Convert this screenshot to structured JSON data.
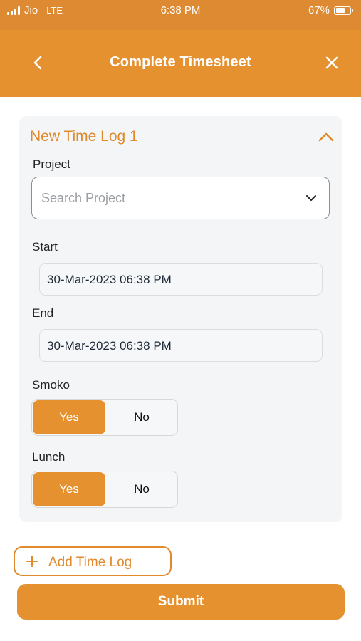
{
  "status_bar": {
    "carrier": "Jio",
    "network": "LTE",
    "time": "6:38 PM",
    "battery": "67%",
    "battery_level": 0.67,
    "icons": [
      "signal-icon",
      "battery-icon"
    ]
  },
  "header": {
    "title": "Complete Timesheet",
    "back_icon": "chevron-left-icon",
    "close_icon": "close-icon"
  },
  "time_log": {
    "title": "New Time Log 1",
    "collapse_icon": "chevron-up-icon",
    "project_label": "Project",
    "project_placeholder": "Search Project",
    "start_label": "Start",
    "start_value": "30-Mar-2023 06:38 PM",
    "end_label": "End",
    "end_value": "30-Mar-2023 06:38 PM",
    "smoko": {
      "label": "Smoko",
      "yes": "Yes",
      "no": "No",
      "selected": "Yes"
    },
    "lunch": {
      "label": "Lunch",
      "yes": "Yes",
      "no": "No",
      "selected": "Yes"
    }
  },
  "actions": {
    "add_time_log": "Add Time Log",
    "submit": "Submit"
  },
  "colors": {
    "accent": "#e5912f",
    "status_bar": "#dd8a32",
    "card_background": "#f3f5f7"
  }
}
